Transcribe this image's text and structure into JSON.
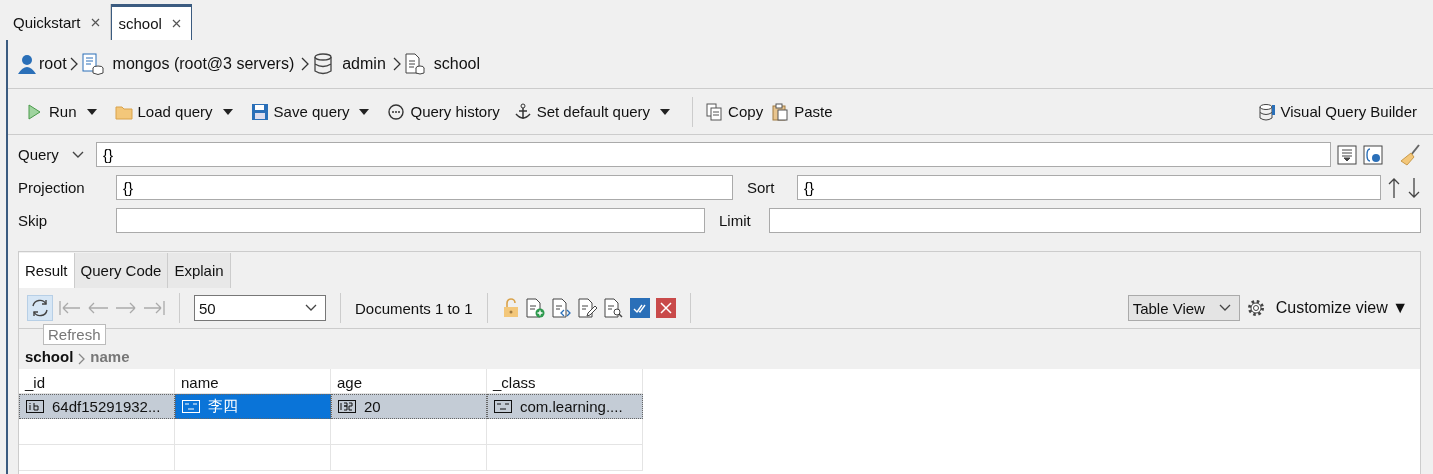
{
  "editor_tabs": [
    {
      "label": "Quickstart",
      "selected": false
    },
    {
      "label": "school",
      "selected": true
    }
  ],
  "breadcrumb": [
    "root",
    "mongos (root@3 servers)",
    "admin",
    "school"
  ],
  "toolbar": {
    "left": [
      {
        "label": "Run",
        "has_menu": true
      },
      {
        "label": "Load query",
        "has_menu": true
      },
      {
        "label": "Save query",
        "has_menu": true
      },
      {
        "label": "Query history",
        "has_menu": false
      },
      {
        "label": "Set default query",
        "has_menu": true
      }
    ],
    "clipboard": [
      {
        "label": "Copy"
      },
      {
        "label": "Paste"
      }
    ],
    "right": {
      "label": "Visual Query Builder"
    }
  },
  "query": {
    "label": "Query",
    "value": "{}"
  },
  "projection": {
    "label": "Projection",
    "value": "{}"
  },
  "sort": {
    "label": "Sort",
    "value": "{}"
  },
  "skip": {
    "label": "Skip"
  },
  "limit": {
    "label": "Limit"
  },
  "result_tabs": [
    {
      "label": "Result",
      "selected": true
    },
    {
      "label": "Query Code",
      "selected": false
    },
    {
      "label": "Explain",
      "selected": false
    }
  ],
  "page_size": "50",
  "documents": "Documents 1 to 1",
  "view_mode": "Table View",
  "customize": "Customize view ▼",
  "tooltip": "Refresh",
  "path": [
    "school",
    "name"
  ],
  "table": {
    "columns": [
      "_id",
      "name",
      "age",
      "_class"
    ],
    "rows": [
      {
        "selected": true,
        "cells": [
          {
            "kind": "id",
            "text": "64df15291932...",
            "focused": false
          },
          {
            "kind": "string",
            "text": "李四",
            "focused": true
          },
          {
            "kind": "int",
            "text": "20",
            "focused": false
          },
          {
            "kind": "string",
            "text": "com.learning....",
            "focused": false
          }
        ]
      }
    ]
  }
}
